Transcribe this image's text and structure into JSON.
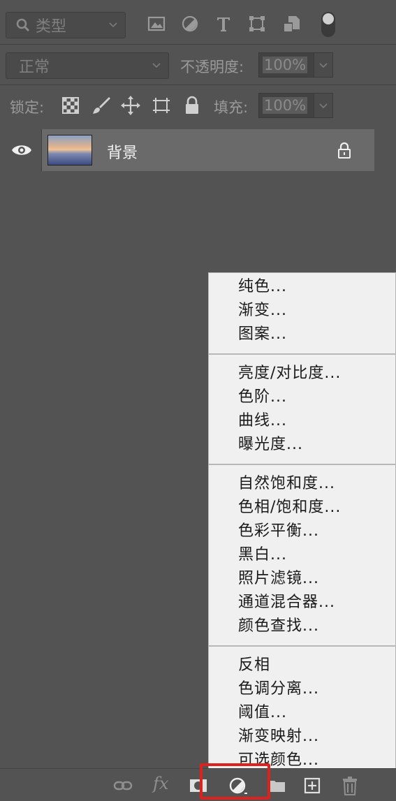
{
  "filter_bar": {
    "kind_label": "类型",
    "icons": [
      "image-filter-icon",
      "adjustment-filter-icon",
      "type-filter-icon",
      "shape-filter-icon",
      "smart-object-filter-icon",
      "filter-toggle"
    ]
  },
  "blend_row": {
    "mode": "正常",
    "opacity_label": "不透明度:",
    "opacity_value": "100%"
  },
  "lock_row": {
    "lock_label": "锁定:",
    "fill_label": "填充:",
    "fill_value": "100%"
  },
  "layer": {
    "name": "背景"
  },
  "menu": {
    "groups": [
      [
        "纯色...",
        "渐变...",
        "图案..."
      ],
      [
        "亮度/对比度...",
        "色阶...",
        "曲线...",
        "曝光度..."
      ],
      [
        "自然饱和度...",
        "色相/饱和度...",
        "色彩平衡...",
        "黑白...",
        "照片滤镜...",
        "通道混合器...",
        "颜色查找..."
      ],
      [
        "反相",
        "色调分离...",
        "阈值...",
        "渐变映射...",
        "可选颜色..."
      ]
    ]
  },
  "bottom_bar": {
    "fx_label": "fx",
    "highlight_color": "#e0201c"
  },
  "colors": {
    "panel_bg": "#535353",
    "selected_layer_bg": "#6a6a6a",
    "menu_bg": "#f0f0f0"
  }
}
